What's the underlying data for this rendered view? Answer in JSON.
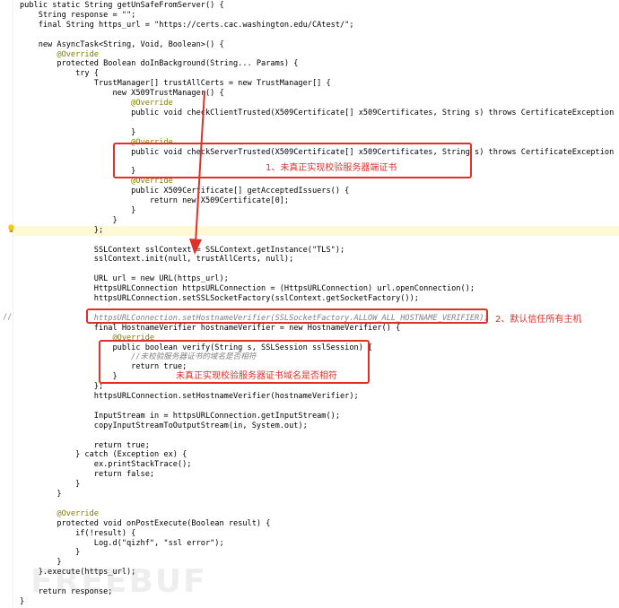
{
  "editor": {
    "lines": [
      {
        "text": "public static String getUnSafeFromServer() {"
      },
      {
        "text": "    String response = \"\";"
      },
      {
        "text": "    final String https_url = \"https://certs.cac.washington.edu/CAtest/\";"
      },
      {
        "text": ""
      },
      {
        "text": "    new AsyncTask<String, Void, Boolean>() {"
      },
      {
        "text": "        @Override",
        "kind": "ann"
      },
      {
        "text": "        protected Boolean doInBackground(String... Params) {"
      },
      {
        "text": "            try {"
      },
      {
        "text": "                TrustManager[] trustAllCerts = new TrustManager[] {"
      },
      {
        "text": "                    new X509TrustManager() {"
      },
      {
        "text": "                        @Override",
        "kind": "ann"
      },
      {
        "text": "                        public void checkClientTrusted(X509Certificate[] x509Certificates, String s) throws CertificateException {"
      },
      {
        "text": ""
      },
      {
        "text": "                        }"
      },
      {
        "text": "                        @Override",
        "kind": "ann"
      },
      {
        "text": "                        public void checkServerTrusted(X509Certificate[] x509Certificates, String s) throws CertificateException {"
      },
      {
        "text": ""
      },
      {
        "text": "                        }"
      },
      {
        "text": "                        @Override",
        "kind": "ann"
      },
      {
        "text": "                        public X509Certificate[] getAcceptedIssuers() {"
      },
      {
        "text": "                            return new X509Certificate[0];"
      },
      {
        "text": "                        }"
      },
      {
        "text": "                    }"
      },
      {
        "text": "                };",
        "highlight": true
      },
      {
        "text": ""
      },
      {
        "text": "                SSLContext sslContext = SSLContext.getInstance(\"TLS\");"
      },
      {
        "text": "                sslContext.init(null, trustAllCerts, null);"
      },
      {
        "text": ""
      },
      {
        "text": "                URL url = new URL(https_url);"
      },
      {
        "text": "                HttpsURLConnection httpsURLConnection = (HttpsURLConnection) url.openConnection();"
      },
      {
        "text": "                httpsURLConnection.setSSLSocketFactory(sslContext.getSocketFactory());"
      },
      {
        "text": ""
      },
      {
        "text": "                httpsURLConnection.setHostnameVerifier(SSLSocketFactory.ALLOW_ALL_HOSTNAME_VERIFIER);",
        "kind": "comment"
      },
      {
        "text": "                final HostnameVerifier hostnameVerifier = new HostnameVerifier() {"
      },
      {
        "text": "                    @Override",
        "kind": "ann"
      },
      {
        "text": "                    public boolean verify(String s, SSLSession sslSession) {"
      },
      {
        "text": "                        //未校验服务器证书的域名是否相符",
        "kind": "comment"
      },
      {
        "text": "                        return true;"
      },
      {
        "text": "                    }"
      },
      {
        "text": "                };"
      },
      {
        "text": "                httpsURLConnection.setHostnameVerifier(hostnameVerifier);"
      },
      {
        "text": ""
      },
      {
        "text": "                InputStream in = httpsURLConnection.getInputStream();"
      },
      {
        "text": "                copyInputStreamToOutputStream(in, System.out);"
      },
      {
        "text": ""
      },
      {
        "text": "                return true;"
      },
      {
        "text": "            } catch (Exception ex) {"
      },
      {
        "text": "                ex.printStackTrace();"
      },
      {
        "text": "                return false;"
      },
      {
        "text": "            }"
      },
      {
        "text": "        }"
      },
      {
        "text": ""
      },
      {
        "text": "        @Override",
        "kind": "ann"
      },
      {
        "text": "        protected void onPostExecute(Boolean result) {"
      },
      {
        "text": "            if(!result) {"
      },
      {
        "text": "                Log.d(\"qizhf\", \"ssl error\");"
      },
      {
        "text": "            }"
      },
      {
        "text": "        }"
      },
      {
        "text": "    }.execute(https_url);"
      },
      {
        "text": ""
      },
      {
        "text": "    return response;"
      },
      {
        "text": "}"
      }
    ],
    "gutter_comment_mark": "//"
  },
  "annotations": {
    "box1_label": "1、未真正实现校验服务器端证书",
    "box2_label": "2、默认信任所有主机",
    "box3_label": "未真正实现校验服务器证书域名是否相符",
    "color": "#e0302a"
  },
  "watermark": "FREEBUF",
  "colors": {
    "keyword": "#000080",
    "string": "#008000",
    "annotation": "#808000",
    "comment": "#808080",
    "number": "#0000ff",
    "field": "#660e7a"
  }
}
